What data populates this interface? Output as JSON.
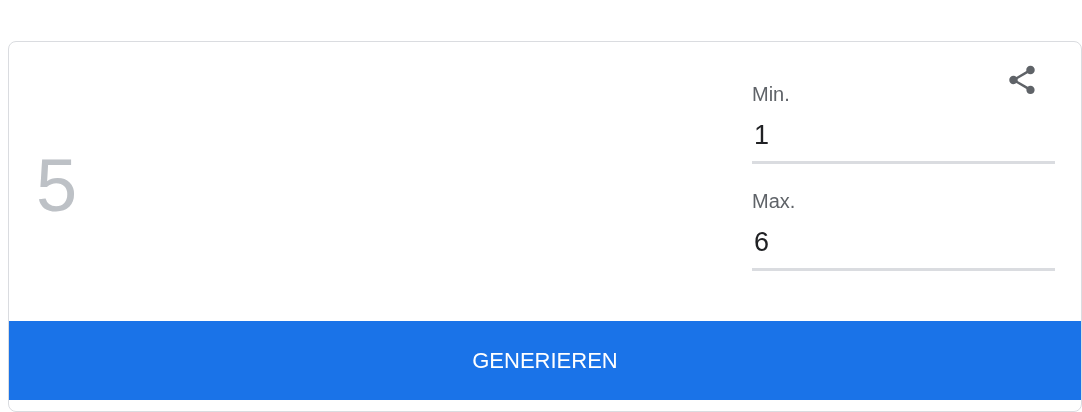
{
  "result": "5",
  "fields": [
    {
      "label": "Min.",
      "value": "1"
    },
    {
      "label": "Max.",
      "value": "6"
    }
  ],
  "button": "GENERIEREN"
}
